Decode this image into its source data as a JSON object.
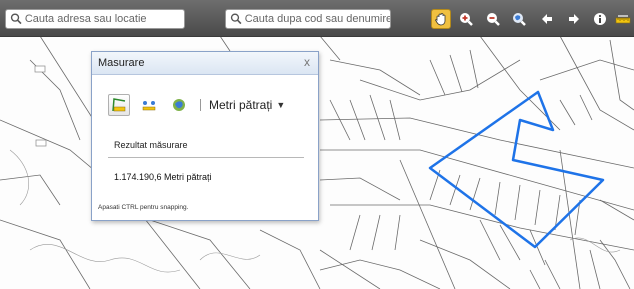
{
  "toolbar": {
    "address_search": {
      "placeholder": "Cauta adresa sau locatie",
      "icon": "search-icon"
    },
    "code_search": {
      "placeholder": "Cauta dupa cod sau denumire",
      "icon": "search-icon"
    },
    "tools": [
      {
        "name": "pan-icon",
        "active": true
      },
      {
        "name": "zoom-in-icon"
      },
      {
        "name": "zoom-out-icon"
      },
      {
        "name": "full-extent-icon"
      },
      {
        "name": "arrow-left-icon"
      },
      {
        "name": "arrow-right-icon"
      },
      {
        "name": "info-icon"
      },
      {
        "name": "measure-tool-icon"
      }
    ]
  },
  "measure_panel": {
    "title": "Masurare",
    "close_glyph": "x",
    "tools": [
      "measure-distance-icon",
      "measure-area-icon",
      "measure-location-icon"
    ],
    "unit_selected": "Metri pătrați",
    "result_label": "Rezultat măsurare",
    "result_value": "1.174.190,6 Metri pătrați",
    "hint": "Apasati CTRL pentru snapping."
  },
  "colors": {
    "toolbar_bg": "#5a5a5a",
    "measured_polygon": "#1e73e8",
    "panel_border": "#8aa2c8",
    "map_lines": "#6a6a6a"
  }
}
